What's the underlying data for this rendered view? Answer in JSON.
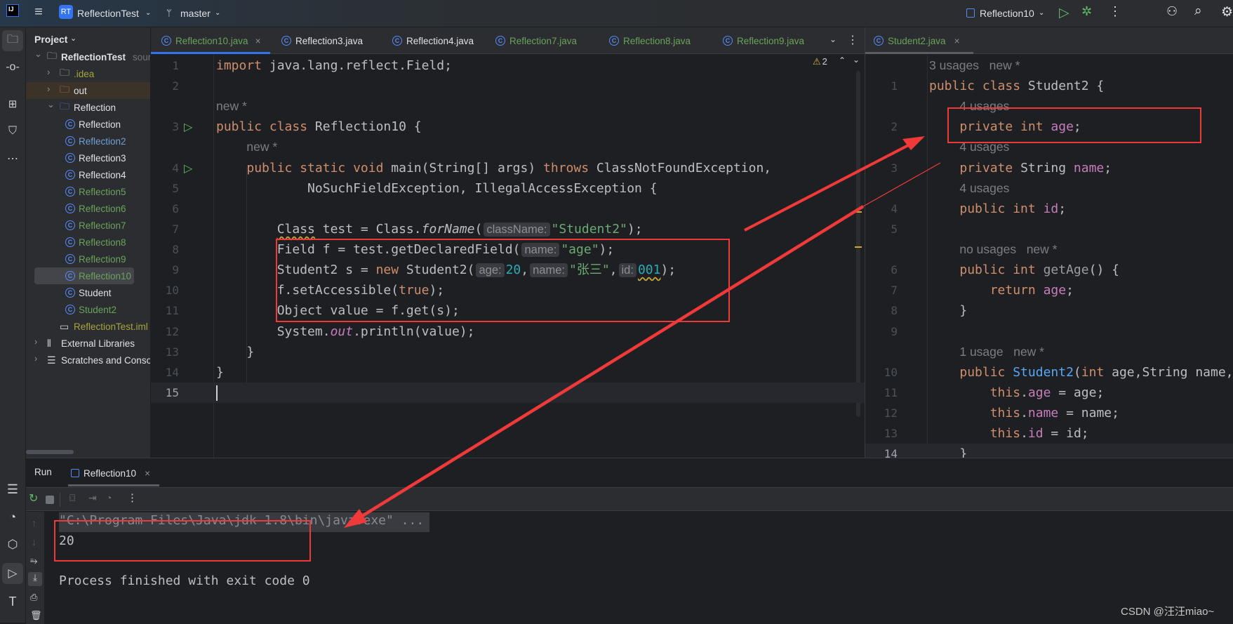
{
  "titlebar": {
    "project_badge": "RT",
    "project_name": "ReflectionTest",
    "branch": "master",
    "run_config": "Reflection10"
  },
  "project_panel": {
    "title": "Project",
    "items": [
      {
        "label": "ReflectionTest",
        "suffix": "sourc",
        "depth": 0,
        "arrow": "down",
        "icon": "module-folder",
        "color": "#dfe1e5"
      },
      {
        "label": ".idea",
        "depth": 1,
        "arrow": "right",
        "icon": "folder",
        "color": "#a8a43c"
      },
      {
        "label": "out",
        "depth": 1,
        "arrow": "right",
        "icon": "folder-orange",
        "color": "#dfe1e5",
        "highlight": "out"
      },
      {
        "label": "Reflection",
        "depth": 1,
        "arrow": "down",
        "icon": "folder-blue",
        "color": "#dfe1e5"
      },
      {
        "label": "Reflection",
        "depth": 2,
        "icon": "class",
        "color": "#dfe1e5"
      },
      {
        "label": "Reflection2",
        "depth": 2,
        "icon": "class",
        "color": "#6f9fd6"
      },
      {
        "label": "Reflection3",
        "depth": 2,
        "icon": "class",
        "color": "#dfe1e5"
      },
      {
        "label": "Reflection4",
        "depth": 2,
        "icon": "class",
        "color": "#dfe1e5"
      },
      {
        "label": "Reflection5",
        "depth": 2,
        "icon": "class",
        "color": "#6aa35a"
      },
      {
        "label": "Reflection6",
        "depth": 2,
        "icon": "class",
        "color": "#6aa35a"
      },
      {
        "label": "Reflection7",
        "depth": 2,
        "icon": "class",
        "color": "#6aa35a"
      },
      {
        "label": "Reflection8",
        "depth": 2,
        "icon": "class",
        "color": "#6aa35a"
      },
      {
        "label": "Reflection9",
        "depth": 2,
        "icon": "class",
        "color": "#6aa35a"
      },
      {
        "label": "Reflection10",
        "depth": 2,
        "icon": "class",
        "color": "#6aa35a",
        "highlight": "selected"
      },
      {
        "label": "Student",
        "depth": 2,
        "icon": "class",
        "color": "#dfe1e5"
      },
      {
        "label": "Student2",
        "depth": 2,
        "icon": "class",
        "color": "#6aa35a"
      },
      {
        "label": "ReflectionTest.iml",
        "depth": 1,
        "icon": "file",
        "color": "#a8a43c"
      },
      {
        "label": "External Libraries",
        "depth": 0,
        "arrow": "right",
        "icon": "library",
        "color": "#dfe1e5"
      },
      {
        "label": "Scratches and Consoles",
        "depth": 0,
        "arrow": "right",
        "icon": "scratches",
        "color": "#dfe1e5"
      }
    ]
  },
  "editor_tabs": [
    {
      "label": "Reflection10.java",
      "color": "#6aa35a",
      "active": true,
      "closable": true
    },
    {
      "label": "Reflection3.java",
      "color": "#dfe1e5"
    },
    {
      "label": "Reflection4.java",
      "color": "#dfe1e5"
    },
    {
      "label": "Reflection7.java",
      "color": "#6aa35a"
    },
    {
      "label": "Reflection8.java",
      "color": "#6aa35a"
    },
    {
      "label": "Reflection9.java",
      "color": "#6aa35a"
    }
  ],
  "right_tab": {
    "label": "Student2.java",
    "color": "#6aa35a"
  },
  "inspection": {
    "warnings": "2"
  },
  "left_code": [
    {
      "n": "1",
      "t": [
        [
          "k",
          "import"
        ],
        [
          "p",
          " java.lang.reflect.Field;"
        ]
      ]
    },
    {
      "n": "2",
      "t": []
    },
    {
      "n": "",
      "t": [
        [
          "u",
          "new *"
        ]
      ]
    },
    {
      "n": "3",
      "run": true,
      "t": [
        [
          "k",
          "public class "
        ],
        [
          "p",
          "Reflection10 {"
        ]
      ]
    },
    {
      "n": "",
      "t": [
        [
          "p",
          "    "
        ],
        [
          "u",
          "new *"
        ]
      ]
    },
    {
      "n": "4",
      "run": true,
      "t": [
        [
          "p",
          "    "
        ],
        [
          "k",
          "public static void "
        ],
        [
          "p",
          "main(String[] args) "
        ],
        [
          "k",
          "throws "
        ],
        [
          "p",
          "ClassNotFoundException,"
        ]
      ]
    },
    {
      "n": "5",
      "t": [
        [
          "p",
          "            NoSuchFieldException, IllegalAccessException {"
        ]
      ]
    },
    {
      "n": "6",
      "t": []
    },
    {
      "n": "7",
      "t": [
        [
          "p",
          "        "
        ],
        [
          "w",
          "Class"
        ],
        [
          "p",
          " test = Class."
        ],
        [
          "i",
          "forName"
        ],
        [
          "p",
          "("
        ],
        [
          "h",
          "className:"
        ],
        [
          "s",
          "\"Student2\""
        ],
        [
          "p",
          ");"
        ]
      ]
    },
    {
      "n": "8",
      "t": [
        [
          "p",
          "        Field f = test.getDeclaredField("
        ],
        [
          "h",
          "name:"
        ],
        [
          "s",
          "\"age\""
        ],
        [
          "p",
          ");"
        ]
      ]
    },
    {
      "n": "9",
      "t": [
        [
          "p",
          "        Student2 s = "
        ],
        [
          "k",
          "new"
        ],
        [
          "p",
          " Student2("
        ],
        [
          "h",
          "age:"
        ],
        [
          "n",
          "20"
        ],
        [
          "p",
          ","
        ],
        [
          "h",
          "name:"
        ],
        [
          "s",
          "\"张三\""
        ],
        [
          "p",
          ","
        ],
        [
          "h",
          "id:"
        ],
        [
          "nu",
          "001"
        ],
        [
          "p",
          ");"
        ]
      ]
    },
    {
      "n": "10",
      "t": [
        [
          "p",
          "        f.setAccessible("
        ],
        [
          "k",
          "true"
        ],
        [
          "p",
          ");"
        ]
      ]
    },
    {
      "n": "11",
      "t": [
        [
          "p",
          "        Object value = f.get(s);"
        ]
      ]
    },
    {
      "n": "12",
      "t": [
        [
          "p",
          "        System."
        ],
        [
          "o",
          "out"
        ],
        [
          "p",
          ".println(value);"
        ]
      ]
    },
    {
      "n": "13",
      "t": [
        [
          "p",
          "    }"
        ]
      ]
    },
    {
      "n": "14",
      "t": [
        [
          "p",
          "}"
        ]
      ]
    },
    {
      "n": "15",
      "current": true,
      "t": []
    }
  ],
  "right_code": [
    {
      "n": "",
      "t": [
        [
          "u",
          "3 usages   new *"
        ]
      ]
    },
    {
      "n": "1",
      "t": [
        [
          "k",
          "public class "
        ],
        [
          "p",
          "Student2 {"
        ]
      ]
    },
    {
      "n": "",
      "t": [
        [
          "p",
          "    "
        ],
        [
          "u",
          "4 usages"
        ]
      ]
    },
    {
      "n": "2",
      "t": [
        [
          "p",
          "    "
        ],
        [
          "k",
          "private int "
        ],
        [
          "f",
          "age"
        ],
        [
          "p",
          ";"
        ]
      ]
    },
    {
      "n": "",
      "t": [
        [
          "p",
          "    "
        ],
        [
          "u",
          "4 usages"
        ]
      ]
    },
    {
      "n": "3",
      "t": [
        [
          "p",
          "    "
        ],
        [
          "k",
          "private "
        ],
        [
          "p",
          "String "
        ],
        [
          "f",
          "name"
        ],
        [
          "p",
          ";"
        ]
      ]
    },
    {
      "n": "",
      "t": [
        [
          "p",
          "    "
        ],
        [
          "u",
          "4 usages"
        ]
      ]
    },
    {
      "n": "4",
      "t": [
        [
          "p",
          "    "
        ],
        [
          "k",
          "public int "
        ],
        [
          "f",
          "id"
        ],
        [
          "p",
          ";"
        ]
      ]
    },
    {
      "n": "5",
      "t": []
    },
    {
      "n": "",
      "t": [
        [
          "p",
          "    "
        ],
        [
          "u",
          "no usages   new *"
        ]
      ]
    },
    {
      "n": "6",
      "t": [
        [
          "p",
          "    "
        ],
        [
          "k",
          "public int "
        ],
        [
          "g",
          "getAge"
        ],
        [
          "p",
          "() {"
        ]
      ]
    },
    {
      "n": "7",
      "t": [
        [
          "p",
          "        "
        ],
        [
          "k",
          "return "
        ],
        [
          "f",
          "age"
        ],
        [
          "p",
          ";"
        ]
      ]
    },
    {
      "n": "8",
      "t": [
        [
          "p",
          "    }"
        ]
      ]
    },
    {
      "n": "9",
      "t": []
    },
    {
      "n": "",
      "t": [
        [
          "p",
          "    "
        ],
        [
          "u",
          "1 usage   new *"
        ]
      ]
    },
    {
      "n": "10",
      "t": [
        [
          "p",
          "    "
        ],
        [
          "k",
          "public "
        ],
        [
          "m",
          "Student2"
        ],
        [
          "p",
          "("
        ],
        [
          "k",
          "int "
        ],
        [
          "p",
          "age,String name,"
        ]
      ]
    },
    {
      "n": "11",
      "t": [
        [
          "p",
          "        "
        ],
        [
          "k",
          "this"
        ],
        [
          "p",
          "."
        ],
        [
          "f",
          "age"
        ],
        [
          "p",
          " = age;"
        ]
      ]
    },
    {
      "n": "12",
      "t": [
        [
          "p",
          "        "
        ],
        [
          "k",
          "this"
        ],
        [
          "p",
          "."
        ],
        [
          "f",
          "name"
        ],
        [
          "p",
          " = name;"
        ]
      ]
    },
    {
      "n": "13",
      "t": [
        [
          "p",
          "        "
        ],
        [
          "k",
          "this"
        ],
        [
          "p",
          "."
        ],
        [
          "f",
          "id"
        ],
        [
          "p",
          " = id;"
        ]
      ]
    },
    {
      "n": "14",
      "current": true,
      "t": [
        [
          "p",
          "    }"
        ]
      ]
    }
  ],
  "run_panel": {
    "title": "Run",
    "tab_label": "Reflection10",
    "console": {
      "command": "\"C:\\Program Files\\Java\\jdk-1.8\\bin\\java.exe\" ...",
      "output": "20",
      "exit_message": "Process finished with exit code 0"
    }
  },
  "watermark": "CSDN @汪汪miao~",
  "colors": {
    "annotation_red": "#f03a3a",
    "accent": "#3574f0",
    "keyword": "#cf8e6d",
    "string": "#6aab73",
    "number": "#2aacb8",
    "field": "#c77dbb"
  }
}
